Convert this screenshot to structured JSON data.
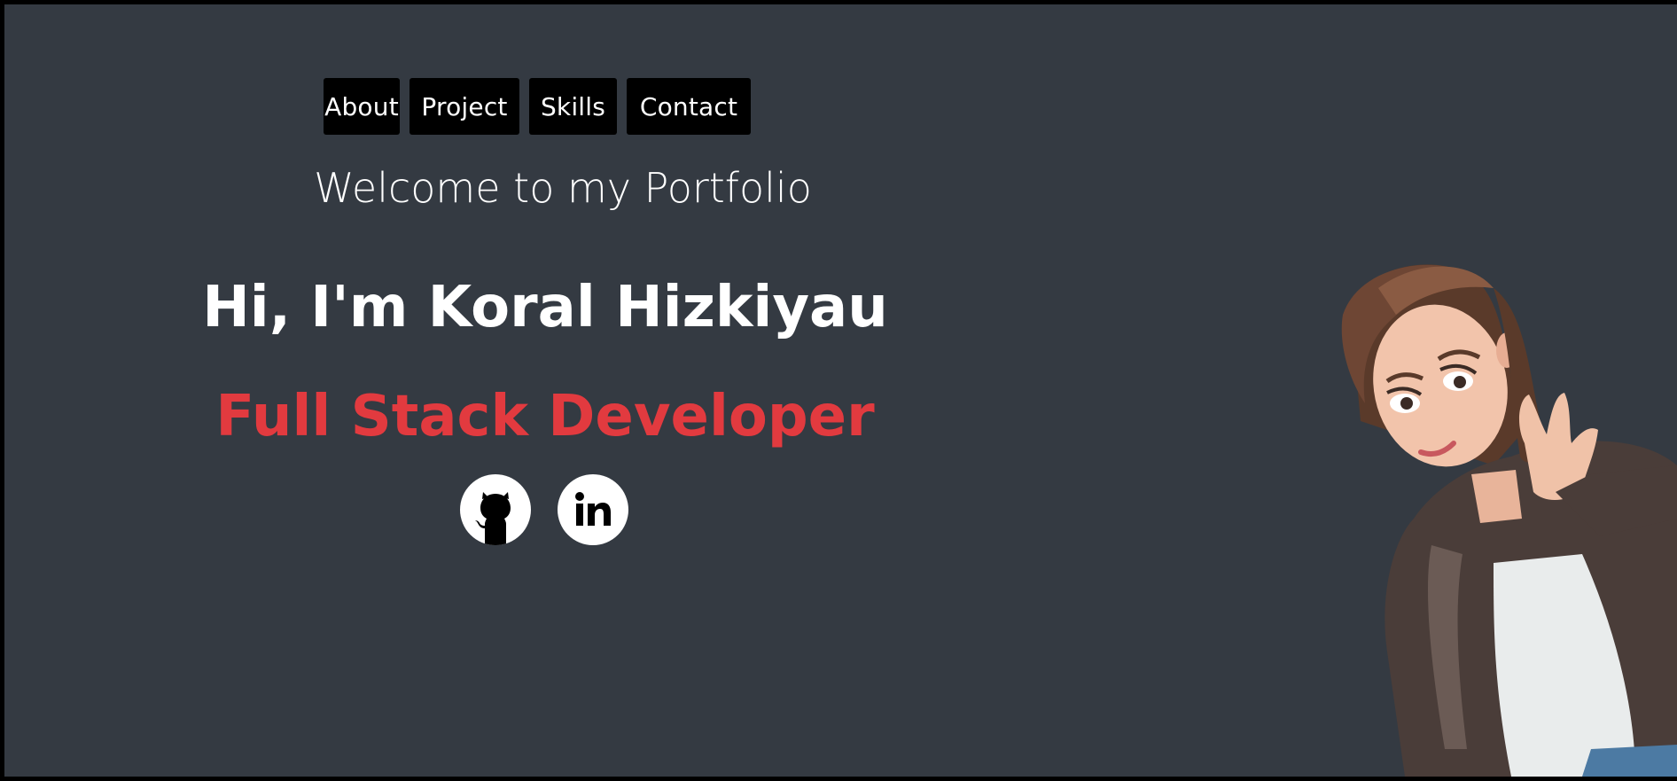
{
  "nav": {
    "items": [
      {
        "label": "About"
      },
      {
        "label": "Project"
      },
      {
        "label": "Skills"
      },
      {
        "label": "Contact"
      }
    ]
  },
  "hero": {
    "welcome": "Welcome to my Portfolio",
    "name": "Hi, I'm Koral Hizkiyau",
    "role": "Full Stack Developer"
  },
  "socials": [
    {
      "icon": "github-icon"
    },
    {
      "icon": "linkedin-icon"
    }
  ],
  "colors": {
    "background": "#343a42",
    "accent": "#e23a3f",
    "nav_button": "#000000",
    "text": "#ffffff"
  }
}
